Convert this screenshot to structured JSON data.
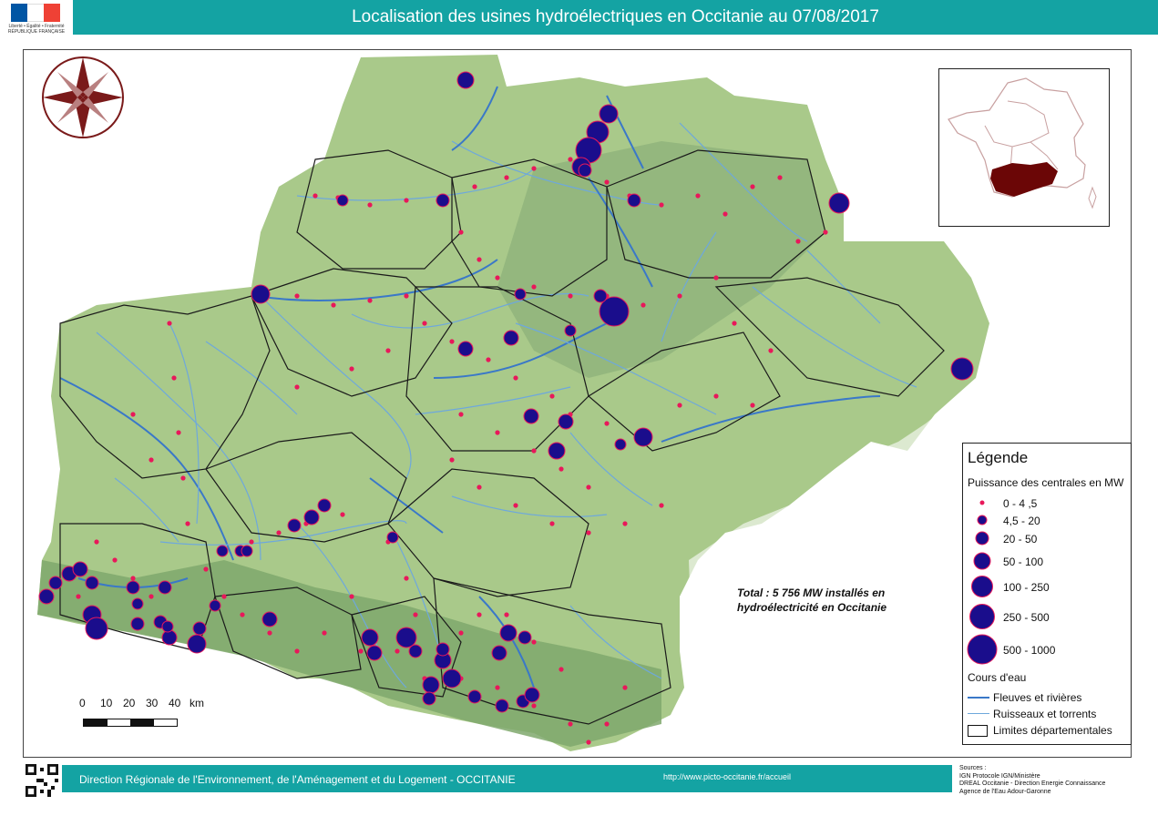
{
  "header": {
    "title": "Localisation des usines hydroélectriques en Occitanie au 07/08/2017",
    "logo_caption": "Liberté • Égalité • Fraternité",
    "logo_republic": "RÉPUBLIQUE FRANÇAISE",
    "flag_colors": [
      "#0055a4",
      "#ffffff",
      "#ef4135"
    ]
  },
  "map": {
    "compass_color": "#7a1a1a",
    "river_color": "#3a78c8",
    "stream_color": "#6ea8dc",
    "plant_color_small": "#e8185a",
    "plant_color_large": "#1a0d8c",
    "region_color_inset": "#6b0606",
    "total_line1": "Total :  5 756 MW installés en",
    "total_line2": "hydroélectricité en Occitanie"
  },
  "legend": {
    "title": "Légende",
    "power_heading": "Puissance des centrales en MW",
    "classes": [
      "0 - 4 ,5",
      "4,5 - 20",
      "20 - 50",
      "50 - 100",
      "100 - 250",
      "250 - 500",
      "500 - 1000"
    ],
    "water_heading": "Cours d'eau",
    "rivers": "Fleuves et rivières",
    "streams": "Ruisseaux et torrents",
    "boundaries": "Limites départementales"
  },
  "scale": {
    "labels": [
      "0",
      "10",
      "20",
      "30",
      "40",
      "km"
    ]
  },
  "footer": {
    "org": "Direction Régionale de l'Environnement, de l'Aménagement et du Logement - OCCITANIE",
    "url": "http://www.picto-occitanie.fr/accueil",
    "sources_title": "Sources :",
    "sources": [
      "IGN Protocole IGN/Ministère",
      "DREAL Occitanie - Direction Energie Connaissance",
      "Agence de l'Eau Adour-Garonne"
    ]
  }
}
